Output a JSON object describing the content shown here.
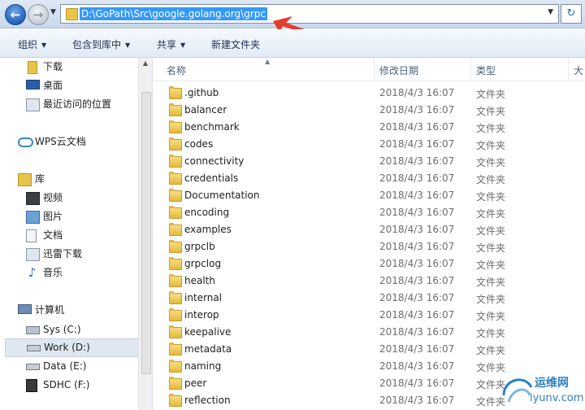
{
  "address": {
    "path": "D:\\GoPath\\Src\\google.golang.org\\grpc"
  },
  "toolbar": {
    "organize": "组织",
    "include_in_library": "包含到库中",
    "share": "共享",
    "new_folder": "新建文件夹"
  },
  "nav": {
    "downloads": "下载",
    "desktop": "桌面",
    "recent": "最近访问的位置",
    "wps": "WPS云文档",
    "libraries": "库",
    "videos": "视频",
    "pictures": "图片",
    "documents": "文档",
    "thunder": "迅雷下载",
    "music": "音乐",
    "computer": "计算机",
    "sys_c": "Sys (C:)",
    "work_d": "Work (D:)",
    "data_e": "Data (E:)",
    "sdhc_f": "SDHC (F:)"
  },
  "columns": {
    "name": "名称",
    "modified": "修改日期",
    "type": "类型",
    "size": "大"
  },
  "files": [
    {
      "name": ".github",
      "date": "2018/4/3 16:07",
      "type": "文件夹"
    },
    {
      "name": "balancer",
      "date": "2018/4/3 16:07",
      "type": "文件夹"
    },
    {
      "name": "benchmark",
      "date": "2018/4/3 16:07",
      "type": "文件夹"
    },
    {
      "name": "codes",
      "date": "2018/4/3 16:07",
      "type": "文件夹"
    },
    {
      "name": "connectivity",
      "date": "2018/4/3 16:07",
      "type": "文件夹"
    },
    {
      "name": "credentials",
      "date": "2018/4/3 16:07",
      "type": "文件夹"
    },
    {
      "name": "Documentation",
      "date": "2018/4/3 16:07",
      "type": "文件夹"
    },
    {
      "name": "encoding",
      "date": "2018/4/3 16:07",
      "type": "文件夹"
    },
    {
      "name": "examples",
      "date": "2018/4/3 16:07",
      "type": "文件夹"
    },
    {
      "name": "grpclb",
      "date": "2018/4/3 16:07",
      "type": "文件夹"
    },
    {
      "name": "grpclog",
      "date": "2018/4/3 16:07",
      "type": "文件夹"
    },
    {
      "name": "health",
      "date": "2018/4/3 16:07",
      "type": "文件夹"
    },
    {
      "name": "internal",
      "date": "2018/4/3 16:07",
      "type": "文件夹"
    },
    {
      "name": "interop",
      "date": "2018/4/3 16:07",
      "type": "文件夹"
    },
    {
      "name": "keepalive",
      "date": "2018/4/3 16:07",
      "type": "文件夹"
    },
    {
      "name": "metadata",
      "date": "2018/4/3 16:07",
      "type": "文件夹"
    },
    {
      "name": "naming",
      "date": "2018/4/3 16:07",
      "type": "文件夹"
    },
    {
      "name": "peer",
      "date": "2018/4/3 16:07",
      "type": "文件夹"
    },
    {
      "name": "reflection",
      "date": "2018/4/3 16:07",
      "type": "文件夹"
    }
  ],
  "watermark": {
    "brand": "运维网",
    "domain": "iyunv.com"
  }
}
